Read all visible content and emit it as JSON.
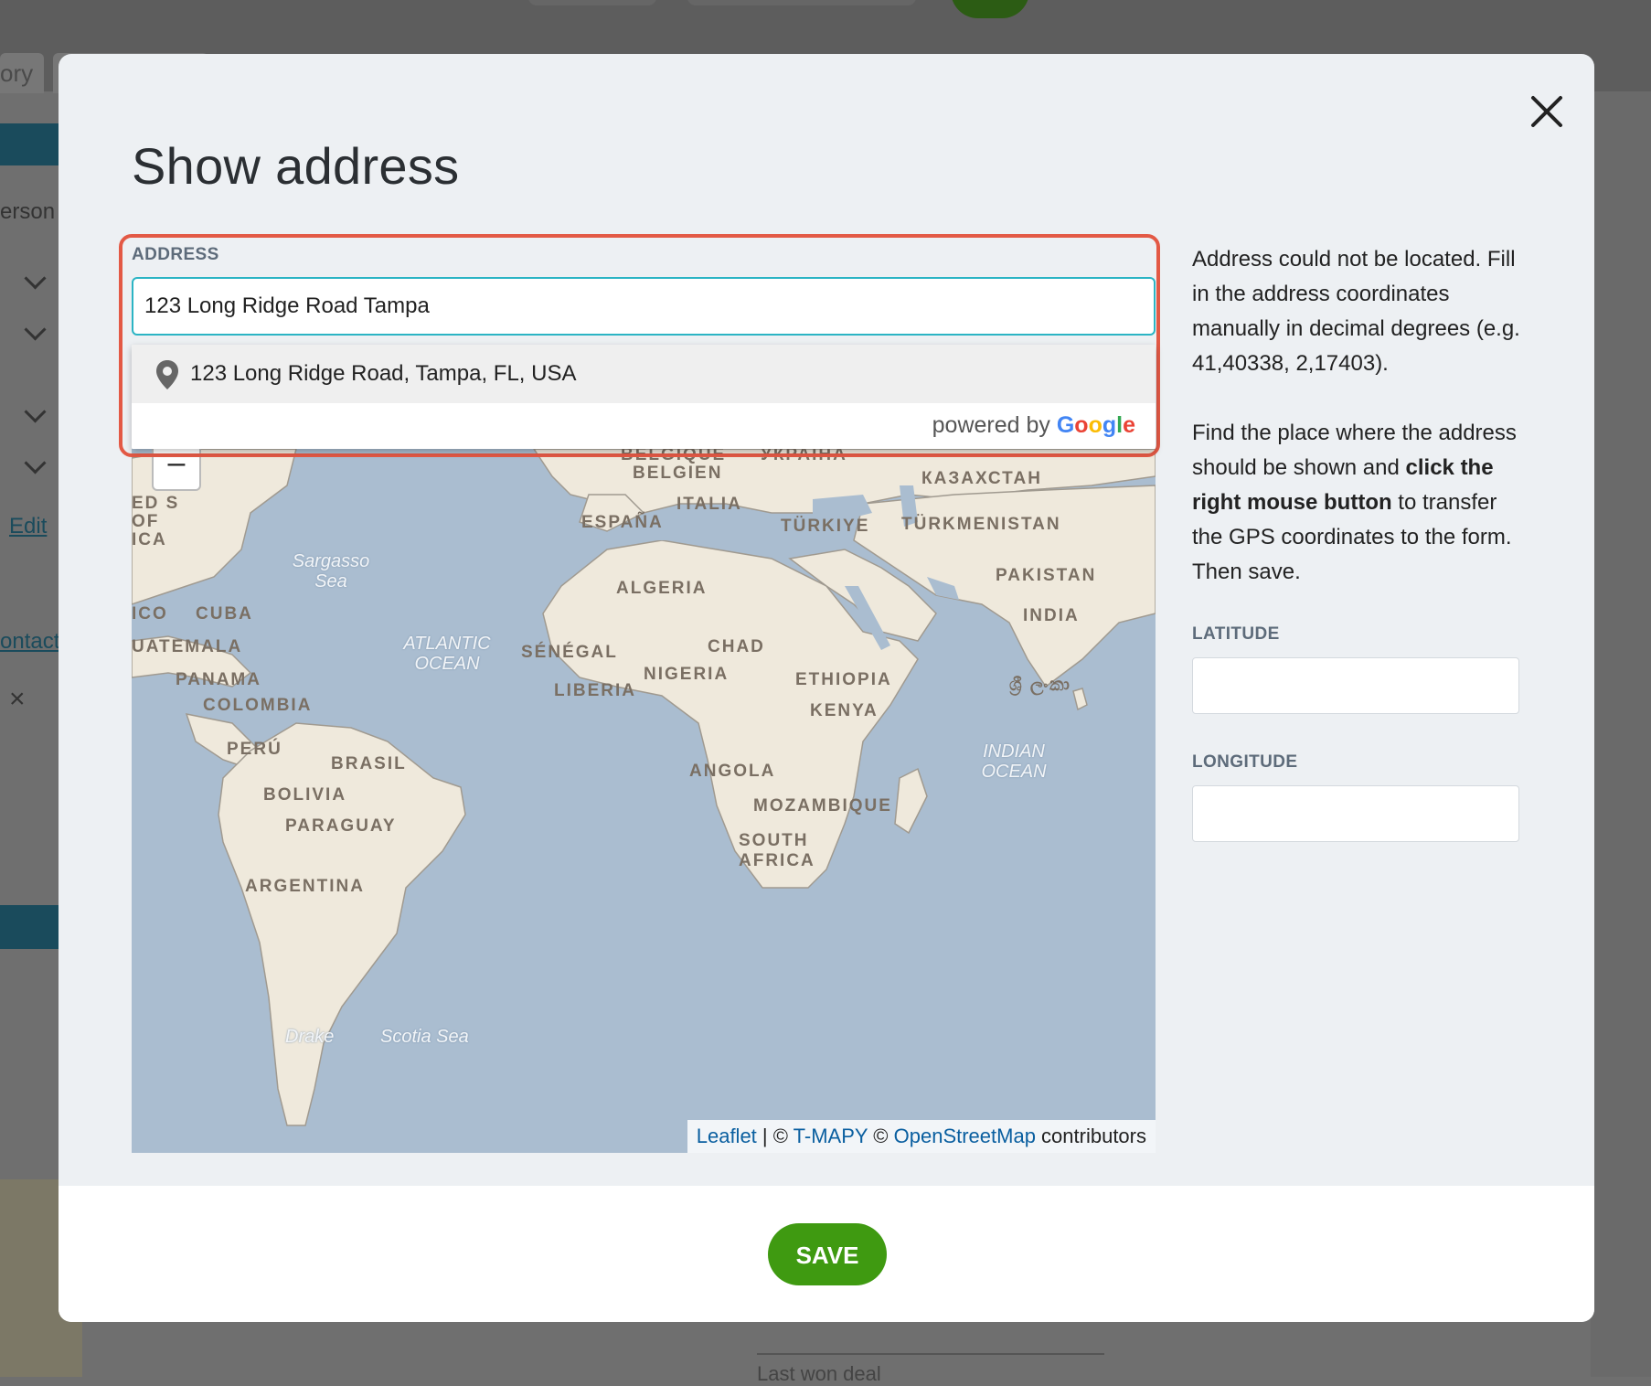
{
  "background": {
    "tab_text": "ory",
    "person_text": "erson",
    "edit_link": "Edit",
    "contact_link": "ontact",
    "close_glyph": "×",
    "last_won_deal": "Last won deal"
  },
  "modal": {
    "title": "Show address",
    "address_label": "ADDRESS",
    "address_value": "123 Long Ridge Road Tampa",
    "suggestion": "123 Long Ridge Road, Tampa, FL, USA",
    "powered_by": "powered by",
    "google_letters": [
      "G",
      "o",
      "o",
      "g",
      "l",
      "e"
    ],
    "google_colors": [
      "#4285F4",
      "#EA4335",
      "#FBBC05",
      "#4285F4",
      "#34A853",
      "#EA4335"
    ],
    "help_paragraph_1": "Address could not be located. Fill in the address coordinates manually in decimal degrees (e.g. 41,40338, 2,17403).",
    "help_p2_a": "Find the place where the address should be shown and ",
    "help_p2_bold": "click the right mouse button",
    "help_p2_b": " to transfer the GPS coordinates to the form. Then save.",
    "latitude_label": "LATITUDE",
    "latitude_value": "",
    "longitude_label": "LONGITUDE",
    "longitude_value": "",
    "save_label": "SAVE",
    "accent_color": "#3f9a11",
    "highlight_color": "#e35945"
  },
  "map": {
    "zoom_out": "–",
    "labels": [
      "BELGIQUE",
      "BELGIEN",
      "УКРАЇНА",
      "КАЗАХСТАН",
      "ITALIA",
      "ESPAÑA",
      "TÜRKIYE",
      "TÜRKMENISTAN",
      "ALGERIA",
      "PAKISTAN",
      "INDIA",
      "CUBA",
      "UATEMALA",
      "PANAMA",
      "COLOMBIA",
      "SÉNÉGAL",
      "CHAD",
      "NIGERIA",
      "LIBERIA",
      "ETHIOPIA",
      "KENYA",
      "PERÚ",
      "BRASIL",
      "BOLIVIA",
      "PARAGUAY",
      "ANGOLA",
      "MOZAMBIQUE",
      "SOUTH AFRICA",
      "ARGENTINA",
      "ED S OF ICA",
      "ICO",
      "ශ්‍රී ලංකා"
    ],
    "oceans": [
      "Sargasso Sea",
      "ATLANTIC OCEAN",
      "INDIAN OCEAN",
      "Drake",
      "Scotia Sea"
    ],
    "attribution": {
      "leaflet": "Leaflet",
      "sep1": " | © ",
      "tmapy": "T-MAPY",
      "sep2": " © ",
      "osm": "OpenStreetMap",
      "tail": " contributors"
    }
  }
}
